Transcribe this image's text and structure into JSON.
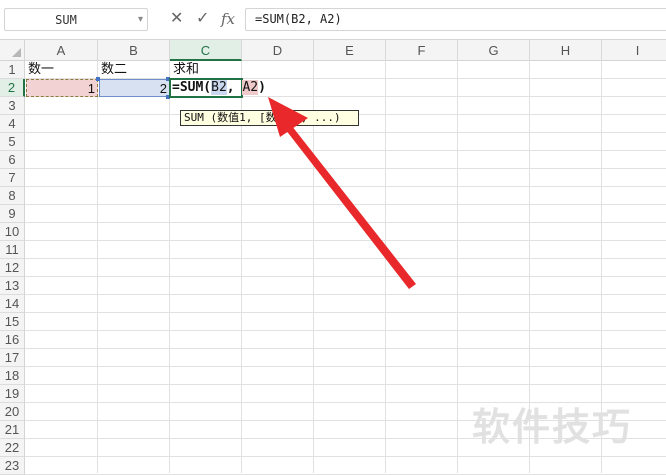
{
  "name_box": {
    "value": "SUM"
  },
  "formula_bar": {
    "cancel_icon": "✕",
    "enter_icon": "✓",
    "fx_icon": "fx",
    "formula": "=SUM(B2, A2)"
  },
  "columns": [
    "A",
    "B",
    "C",
    "D",
    "E",
    "F",
    "G",
    "H",
    "I"
  ],
  "rows": [
    "1",
    "2",
    "3",
    "4",
    "5",
    "6",
    "7",
    "8",
    "9",
    "10",
    "11",
    "12",
    "13",
    "14",
    "15",
    "16",
    "17",
    "18",
    "19",
    "20",
    "21",
    "22",
    "23"
  ],
  "cells": {
    "A1": "数一",
    "B1": "数二",
    "C1": "求和",
    "A2": "1",
    "B2": "2",
    "C2": {
      "part1": "=SUM(",
      "ref1": "B2",
      "sep": ",",
      "ref2": "A2",
      "close": ")"
    }
  },
  "tooltip": "SUM (数值1, [数值2], ...)",
  "watermark": "软件技巧",
  "colors": {
    "accent": "#217346",
    "ref_b2": "#4472c4",
    "ref_a2": "#c0504d",
    "arrow": "#e8282a"
  }
}
